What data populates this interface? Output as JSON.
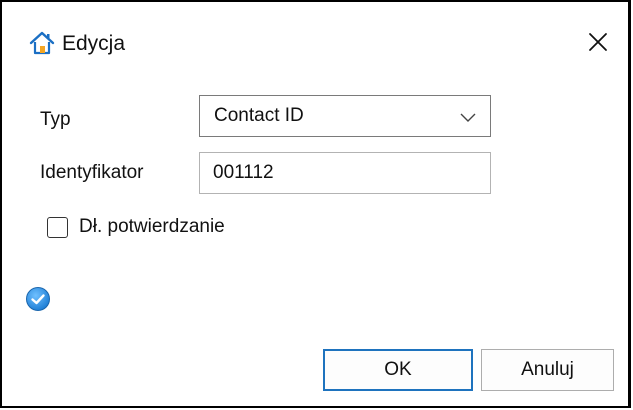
{
  "window": {
    "title": "Edycja",
    "icon": "home-icon",
    "close_icon": "close-icon"
  },
  "form": {
    "type_label": "Typ",
    "type_value": "Contact ID",
    "identifier_label": "Identyfikator",
    "identifier_value": "001112",
    "checkbox_label": "Dł. potwierdzanie",
    "checkbox_checked": false
  },
  "status": {
    "icon": "check-circle-icon",
    "color": "#2b8de0"
  },
  "buttons": {
    "ok_label": "OK",
    "cancel_label": "Anuluj"
  },
  "colors": {
    "accent": "#1e73be",
    "icon_blue": "#1b6fc4"
  }
}
